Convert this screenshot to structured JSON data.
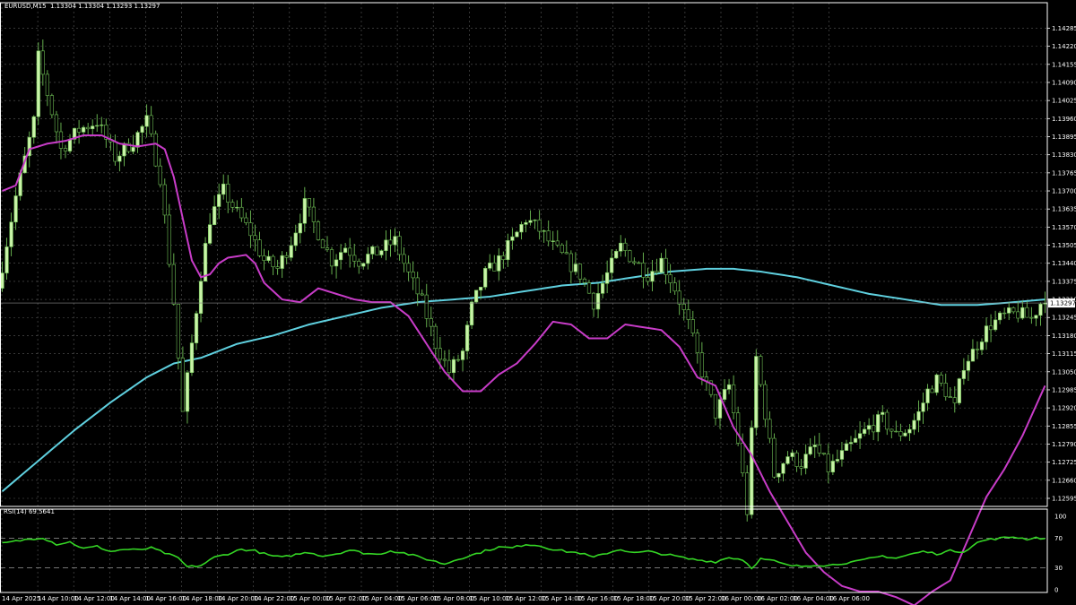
{
  "header": {
    "symbol": "EURUSD,M15",
    "ohlc": "1.13304 1.13304 1.13293 1.13297",
    "rsi_label": "RSI(14) 69.5641"
  },
  "colors": {
    "background": "#000000",
    "grid": "#5a5a5a",
    "frame": "#ffffff",
    "candle_up": "#c9f3a8",
    "candle_down": "#000000",
    "candle_outline": "#6fbf55",
    "fast_ma": "#c83cc8",
    "slow_ma": "#5fd0df",
    "rsi": "#35d625",
    "price_tag_bg": "#ffffff",
    "price_tag_text": "#000000"
  },
  "chart_data": {
    "type": "candlestick",
    "symbol": "EURUSD",
    "timeframe": "M15",
    "price_axis": {
      "range": [
        1.12595,
        1.1428
      ],
      "ticks": [
        "1.14285",
        "1.14220",
        "1.14155",
        "1.14090",
        "1.14025",
        "1.13960",
        "1.13895",
        "1.13830",
        "1.13765",
        "1.13700",
        "1.13635",
        "1.13570",
        "1.13505",
        "1.13440",
        "1.13375",
        "1.13310",
        "1.13245",
        "1.13180",
        "1.13115",
        "1.13050",
        "1.12985",
        "1.12920",
        "1.12855",
        "1.12790",
        "1.12725",
        "1.12660",
        "1.12595"
      ],
      "current_price": "1.13297",
      "current_value": 1.13297
    },
    "time_axis": {
      "labels": [
        "14 Apr 2025",
        "14 Apr 10:00",
        "14 Apr 12:00",
        "14 Apr 14:00",
        "14 Apr 16:00",
        "14 Apr 18:00",
        "14 Apr 20:00",
        "14 Apr 22:00",
        "15 Apr 00:00",
        "15 Apr 02:00",
        "15 Apr 04:00",
        "15 Apr 06:00",
        "15 Apr 08:00",
        "15 Apr 10:00",
        "15 Apr 12:00",
        "15 Apr 14:00",
        "15 Apr 16:00",
        "15 Apr 18:00",
        "15 Apr 20:00",
        "15 Apr 22:00",
        "16 Apr 00:00",
        "16 Apr 02:00",
        "16 Apr 04:00",
        "16 Apr 06:00"
      ]
    },
    "close_series": [
      {
        "t": 0,
        "v": 1.1335
      },
      {
        "t": 4,
        "v": 1.1368
      },
      {
        "t": 8,
        "v": 1.1395
      },
      {
        "t": 9,
        "v": 1.1418
      },
      {
        "t": 11,
        "v": 1.1405
      },
      {
        "t": 14,
        "v": 1.1385
      },
      {
        "t": 18,
        "v": 1.1392
      },
      {
        "t": 22,
        "v": 1.1395
      },
      {
        "t": 26,
        "v": 1.1382
      },
      {
        "t": 30,
        "v": 1.1388
      },
      {
        "t": 33,
        "v": 1.1395
      },
      {
        "t": 36,
        "v": 1.1375
      },
      {
        "t": 39,
        "v": 1.133
      },
      {
        "t": 41,
        "v": 1.129
      },
      {
        "t": 43,
        "v": 1.1315
      },
      {
        "t": 45,
        "v": 1.134
      },
      {
        "t": 47,
        "v": 1.136
      },
      {
        "t": 50,
        "v": 1.137
      },
      {
        "t": 53,
        "v": 1.1362
      },
      {
        "t": 56,
        "v": 1.1355
      },
      {
        "t": 59,
        "v": 1.1345
      },
      {
        "t": 62,
        "v": 1.1342
      },
      {
        "t": 65,
        "v": 1.1352
      },
      {
        "t": 68,
        "v": 1.1365
      },
      {
        "t": 71,
        "v": 1.1355
      },
      {
        "t": 74,
        "v": 1.1345
      },
      {
        "t": 77,
        "v": 1.135
      },
      {
        "t": 80,
        "v": 1.1345
      },
      {
        "t": 84,
        "v": 1.1348
      },
      {
        "t": 88,
        "v": 1.1352
      },
      {
        "t": 91,
        "v": 1.134
      },
      {
        "t": 94,
        "v": 1.133
      },
      {
        "t": 97,
        "v": 1.1315
      },
      {
        "t": 100,
        "v": 1.1305
      },
      {
        "t": 103,
        "v": 1.1312
      },
      {
        "t": 105,
        "v": 1.1328
      },
      {
        "t": 108,
        "v": 1.134
      },
      {
        "t": 111,
        "v": 1.1345
      },
      {
        "t": 114,
        "v": 1.1352
      },
      {
        "t": 117,
        "v": 1.136
      },
      {
        "t": 120,
        "v": 1.1356
      },
      {
        "t": 123,
        "v": 1.135
      },
      {
        "t": 126,
        "v": 1.1345
      },
      {
        "t": 129,
        "v": 1.134
      },
      {
        "t": 132,
        "v": 1.133
      },
      {
        "t": 135,
        "v": 1.134
      },
      {
        "t": 138,
        "v": 1.135
      },
      {
        "t": 141,
        "v": 1.1345
      },
      {
        "t": 144,
        "v": 1.134
      },
      {
        "t": 147,
        "v": 1.1345
      },
      {
        "t": 150,
        "v": 1.1335
      },
      {
        "t": 153,
        "v": 1.1322
      },
      {
        "t": 156,
        "v": 1.1305
      },
      {
        "t": 159,
        "v": 1.129
      },
      {
        "t": 162,
        "v": 1.13
      },
      {
        "t": 164,
        "v": 1.128
      },
      {
        "t": 166,
        "v": 1.1255
      },
      {
        "t": 168,
        "v": 1.131
      },
      {
        "t": 170,
        "v": 1.129
      },
      {
        "t": 172,
        "v": 1.1268
      },
      {
        "t": 175,
        "v": 1.1275
      },
      {
        "t": 178,
        "v": 1.1272
      },
      {
        "t": 181,
        "v": 1.1278
      },
      {
        "t": 184,
        "v": 1.127
      },
      {
        "t": 187,
        "v": 1.1275
      },
      {
        "t": 190,
        "v": 1.128
      },
      {
        "t": 193,
        "v": 1.1285
      },
      {
        "t": 196,
        "v": 1.1288
      },
      {
        "t": 199,
        "v": 1.1282
      },
      {
        "t": 202,
        "v": 1.1285
      },
      {
        "t": 204,
        "v": 1.129
      },
      {
        "t": 206,
        "v": 1.1298
      },
      {
        "t": 208,
        "v": 1.1302
      },
      {
        "t": 210,
        "v": 1.1298
      },
      {
        "t": 212,
        "v": 1.1292
      },
      {
        "t": 214,
        "v": 1.1308
      },
      {
        "t": 216,
        "v": 1.1312
      },
      {
        "t": 218,
        "v": 1.1318
      },
      {
        "t": 220,
        "v": 1.1322
      },
      {
        "t": 223,
        "v": 1.1325
      },
      {
        "t": 226,
        "v": 1.1326
      },
      {
        "t": 229,
        "v": 1.1324
      },
      {
        "t": 231,
        "v": 1.13297
      }
    ],
    "indicators": {
      "fast_ma": {
        "color": "#c83cc8",
        "points": [
          {
            "t": 0,
            "v": 1.137
          },
          {
            "t": 3,
            "v": 1.1372
          },
          {
            "t": 6,
            "v": 1.1385
          },
          {
            "t": 10,
            "v": 1.1387
          },
          {
            "t": 14,
            "v": 1.1388
          },
          {
            "t": 18,
            "v": 1.139
          },
          {
            "t": 22,
            "v": 1.139
          },
          {
            "t": 26,
            "v": 1.1387
          },
          {
            "t": 30,
            "v": 1.1386
          },
          {
            "t": 34,
            "v": 1.1387
          },
          {
            "t": 36,
            "v": 1.1385
          },
          {
            "t": 38,
            "v": 1.1375
          },
          {
            "t": 40,
            "v": 1.136
          },
          {
            "t": 42,
            "v": 1.1345
          },
          {
            "t": 44,
            "v": 1.1339
          },
          {
            "t": 46,
            "v": 1.134
          },
          {
            "t": 48,
            "v": 1.1344
          },
          {
            "t": 50,
            "v": 1.1346
          },
          {
            "t": 54,
            "v": 1.1347
          },
          {
            "t": 56,
            "v": 1.1344
          },
          {
            "t": 58,
            "v": 1.1337
          },
          {
            "t": 62,
            "v": 1.1331
          },
          {
            "t": 66,
            "v": 1.133
          },
          {
            "t": 70,
            "v": 1.1335
          },
          {
            "t": 74,
            "v": 1.1333
          },
          {
            "t": 78,
            "v": 1.1331
          },
          {
            "t": 82,
            "v": 1.133
          },
          {
            "t": 86,
            "v": 1.133
          },
          {
            "t": 90,
            "v": 1.1325
          },
          {
            "t": 94,
            "v": 1.1315
          },
          {
            "t": 98,
            "v": 1.1305
          },
          {
            "t": 102,
            "v": 1.1298
          },
          {
            "t": 106,
            "v": 1.1298
          },
          {
            "t": 110,
            "v": 1.1304
          },
          {
            "t": 114,
            "v": 1.1308
          },
          {
            "t": 118,
            "v": 1.1315
          },
          {
            "t": 122,
            "v": 1.1323
          },
          {
            "t": 126,
            "v": 1.1322
          },
          {
            "t": 130,
            "v": 1.1317
          },
          {
            "t": 134,
            "v": 1.1317
          },
          {
            "t": 138,
            "v": 1.1322
          },
          {
            "t": 142,
            "v": 1.1321
          },
          {
            "t": 146,
            "v": 1.132
          },
          {
            "t": 150,
            "v": 1.1314
          },
          {
            "t": 154,
            "v": 1.1303
          },
          {
            "t": 158,
            "v": 1.13
          },
          {
            "t": 162,
            "v": 1.1285
          },
          {
            "t": 166,
            "v": 1.1275
          },
          {
            "t": 170,
            "v": 1.1262
          },
          {
            "t": 174,
            "v": 1.1251
          },
          {
            "t": 178,
            "v": 1.124
          },
          {
            "t": 182,
            "v": 1.1233
          },
          {
            "t": 186,
            "v": 1.1228
          },
          {
            "t": 190,
            "v": 1.1226
          },
          {
            "t": 194,
            "v": 1.1226
          },
          {
            "t": 198,
            "v": 1.1224
          },
          {
            "t": 202,
            "v": 1.1221
          },
          {
            "t": 206,
            "v": 1.1226
          },
          {
            "t": 210,
            "v": 1.123
          },
          {
            "t": 214,
            "v": 1.1245
          },
          {
            "t": 218,
            "v": 1.126
          },
          {
            "t": 222,
            "v": 1.127
          },
          {
            "t": 226,
            "v": 1.1282
          },
          {
            "t": 231,
            "v": 1.13
          }
        ]
      },
      "slow_ma": {
        "color": "#5fd0df",
        "points": [
          {
            "t": 0,
            "v": 1.1262
          },
          {
            "t": 8,
            "v": 1.1273
          },
          {
            "t": 16,
            "v": 1.1284
          },
          {
            "t": 24,
            "v": 1.1294
          },
          {
            "t": 32,
            "v": 1.1303
          },
          {
            "t": 38,
            "v": 1.1308
          },
          {
            "t": 44,
            "v": 1.131
          },
          {
            "t": 52,
            "v": 1.1315
          },
          {
            "t": 60,
            "v": 1.1318
          },
          {
            "t": 68,
            "v": 1.1322
          },
          {
            "t": 76,
            "v": 1.1325
          },
          {
            "t": 84,
            "v": 1.1328
          },
          {
            "t": 92,
            "v": 1.133
          },
          {
            "t": 100,
            "v": 1.1331
          },
          {
            "t": 108,
            "v": 1.1332
          },
          {
            "t": 116,
            "v": 1.1334
          },
          {
            "t": 124,
            "v": 1.1336
          },
          {
            "t": 132,
            "v": 1.1337
          },
          {
            "t": 140,
            "v": 1.1339
          },
          {
            "t": 148,
            "v": 1.1341
          },
          {
            "t": 156,
            "v": 1.1342
          },
          {
            "t": 162,
            "v": 1.1342
          },
          {
            "t": 168,
            "v": 1.1341
          },
          {
            "t": 176,
            "v": 1.1339
          },
          {
            "t": 184,
            "v": 1.1336
          },
          {
            "t": 192,
            "v": 1.1333
          },
          {
            "t": 200,
            "v": 1.1331
          },
          {
            "t": 208,
            "v": 1.1329
          },
          {
            "t": 216,
            "v": 1.1329
          },
          {
            "t": 224,
            "v": 1.133
          },
          {
            "t": 231,
            "v": 1.1331
          }
        ]
      },
      "rsi": {
        "period": 14,
        "current": "69.5641",
        "range": [
          0,
          100
        ],
        "ticks": [
          "100",
          "70",
          "30",
          "0"
        ],
        "levels": [
          70,
          30
        ],
        "color": "#35d625",
        "points": [
          {
            "t": 0,
            "v": 63
          },
          {
            "t": 3,
            "v": 66
          },
          {
            "t": 6,
            "v": 69
          },
          {
            "t": 9,
            "v": 71
          },
          {
            "t": 12,
            "v": 62
          },
          {
            "t": 15,
            "v": 65
          },
          {
            "t": 18,
            "v": 56
          },
          {
            "t": 21,
            "v": 59
          },
          {
            "t": 24,
            "v": 52
          },
          {
            "t": 27,
            "v": 55
          },
          {
            "t": 30,
            "v": 54
          },
          {
            "t": 33,
            "v": 57
          },
          {
            "t": 36,
            "v": 50
          },
          {
            "t": 39,
            "v": 43
          },
          {
            "t": 41,
            "v": 31
          },
          {
            "t": 44,
            "v": 33
          },
          {
            "t": 47,
            "v": 44
          },
          {
            "t": 50,
            "v": 49
          },
          {
            "t": 53,
            "v": 55
          },
          {
            "t": 56,
            "v": 53
          },
          {
            "t": 59,
            "v": 47
          },
          {
            "t": 62,
            "v": 44
          },
          {
            "t": 65,
            "v": 48
          },
          {
            "t": 68,
            "v": 51
          },
          {
            "t": 71,
            "v": 46
          },
          {
            "t": 74,
            "v": 49
          },
          {
            "t": 77,
            "v": 54
          },
          {
            "t": 80,
            "v": 50
          },
          {
            "t": 83,
            "v": 48
          },
          {
            "t": 86,
            "v": 53
          },
          {
            "t": 89,
            "v": 50
          },
          {
            "t": 92,
            "v": 45
          },
          {
            "t": 95,
            "v": 40
          },
          {
            "t": 98,
            "v": 35
          },
          {
            "t": 101,
            "v": 42
          },
          {
            "t": 104,
            "v": 47
          },
          {
            "t": 107,
            "v": 53
          },
          {
            "t": 110,
            "v": 58
          },
          {
            "t": 113,
            "v": 57
          },
          {
            "t": 116,
            "v": 62
          },
          {
            "t": 119,
            "v": 60
          },
          {
            "t": 122,
            "v": 55
          },
          {
            "t": 125,
            "v": 52
          },
          {
            "t": 128,
            "v": 50
          },
          {
            "t": 131,
            "v": 44
          },
          {
            "t": 134,
            "v": 50
          },
          {
            "t": 137,
            "v": 55
          },
          {
            "t": 140,
            "v": 50
          },
          {
            "t": 143,
            "v": 52
          },
          {
            "t": 146,
            "v": 49
          },
          {
            "t": 149,
            "v": 46
          },
          {
            "t": 152,
            "v": 42
          },
          {
            "t": 155,
            "v": 40
          },
          {
            "t": 158,
            "v": 38
          },
          {
            "t": 161,
            "v": 44
          },
          {
            "t": 164,
            "v": 41
          },
          {
            "t": 166,
            "v": 30
          },
          {
            "t": 168,
            "v": 42
          },
          {
            "t": 171,
            "v": 39
          },
          {
            "t": 174,
            "v": 33
          },
          {
            "t": 177,
            "v": 32
          },
          {
            "t": 180,
            "v": 34
          },
          {
            "t": 183,
            "v": 33
          },
          {
            "t": 186,
            "v": 36
          },
          {
            "t": 189,
            "v": 38
          },
          {
            "t": 192,
            "v": 42
          },
          {
            "t": 195,
            "v": 46
          },
          {
            "t": 198,
            "v": 43
          },
          {
            "t": 201,
            "v": 48
          },
          {
            "t": 204,
            "v": 52
          },
          {
            "t": 207,
            "v": 49
          },
          {
            "t": 210,
            "v": 53
          },
          {
            "t": 213,
            "v": 52
          },
          {
            "t": 216,
            "v": 64
          },
          {
            "t": 218,
            "v": 68
          },
          {
            "t": 221,
            "v": 70
          },
          {
            "t": 224,
            "v": 72
          },
          {
            "t": 227,
            "v": 69
          },
          {
            "t": 229,
            "v": 71
          },
          {
            "t": 231,
            "v": 69.56
          }
        ]
      }
    }
  }
}
